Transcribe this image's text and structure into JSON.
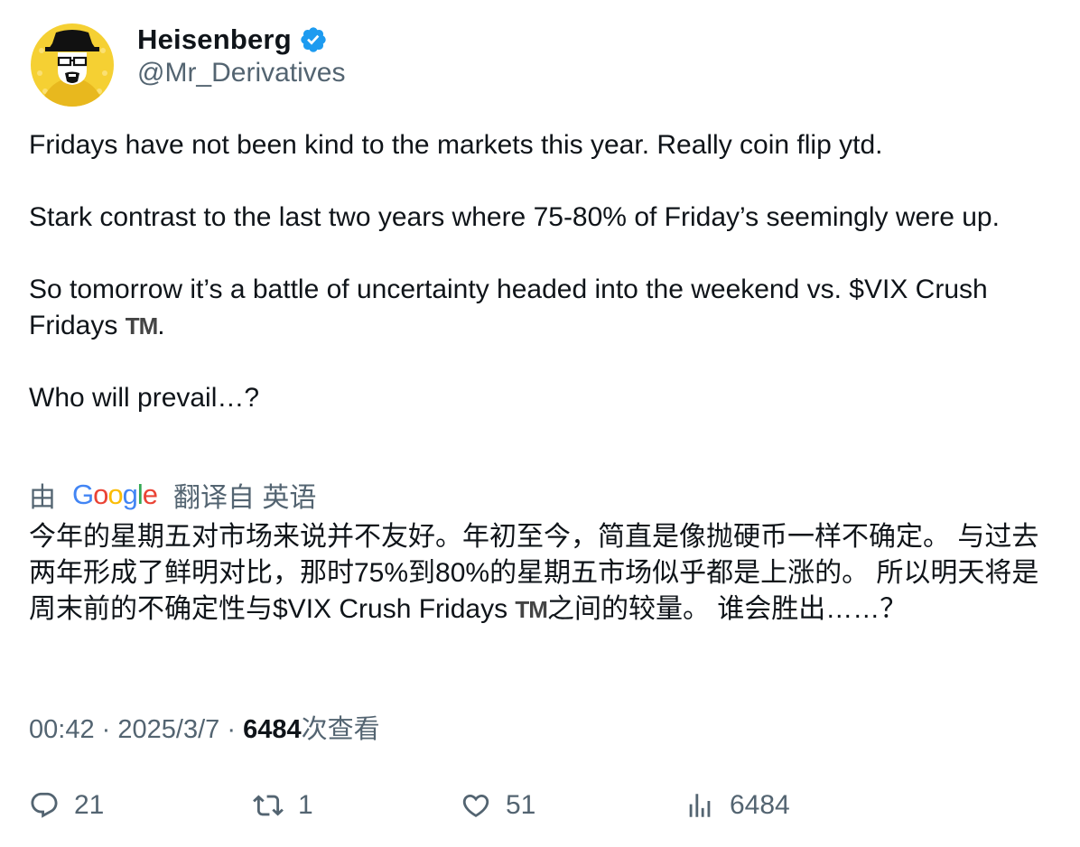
{
  "author": {
    "name": "Heisenberg",
    "handle": "@Mr_Derivatives",
    "verified_icon": "verified-badge-icon",
    "badge_color": "#1D9BF0"
  },
  "tweet": {
    "paragraphs": [
      "Fridays have not been kind to the markets this year. Really coin flip ytd.",
      "Stark contrast to the last two years where 75-80% of Friday’s seemingly were up.",
      "So tomorrow it’s a battle of uncertainty headed into the weekend vs. $VIX Crush Fridays",
      "Who will prevail…?"
    ],
    "tm_glyph": "TM",
    "para3_suffix": "."
  },
  "translation": {
    "prefix": "由",
    "google_letters": [
      "G",
      "o",
      "o",
      "g",
      "l",
      "e"
    ],
    "suffix": "翻译自 英语",
    "text_before_tm": "今年的星期五对市场来说并不友好。年初至今，简直是像抛硬币一样不确定。 与过去两年形成了鲜明对比，那时75%到80%的星期五市场似乎都是上涨的。 所以明天将是周末前的不确定性与$VIX Crush Fridays ",
    "text_after_tm": "之间的较量。 谁会胜出……？"
  },
  "meta": {
    "time": "00:42",
    "separator": "·",
    "date": "2025/3/7",
    "views_count": "6484",
    "views_label": "次查看"
  },
  "actions": {
    "replies": "21",
    "retweets": "1",
    "likes": "51",
    "views": "6484"
  },
  "colors": {
    "text": "#0f1419",
    "secondary": "#536471",
    "avatar_bg": "#F5D033"
  }
}
